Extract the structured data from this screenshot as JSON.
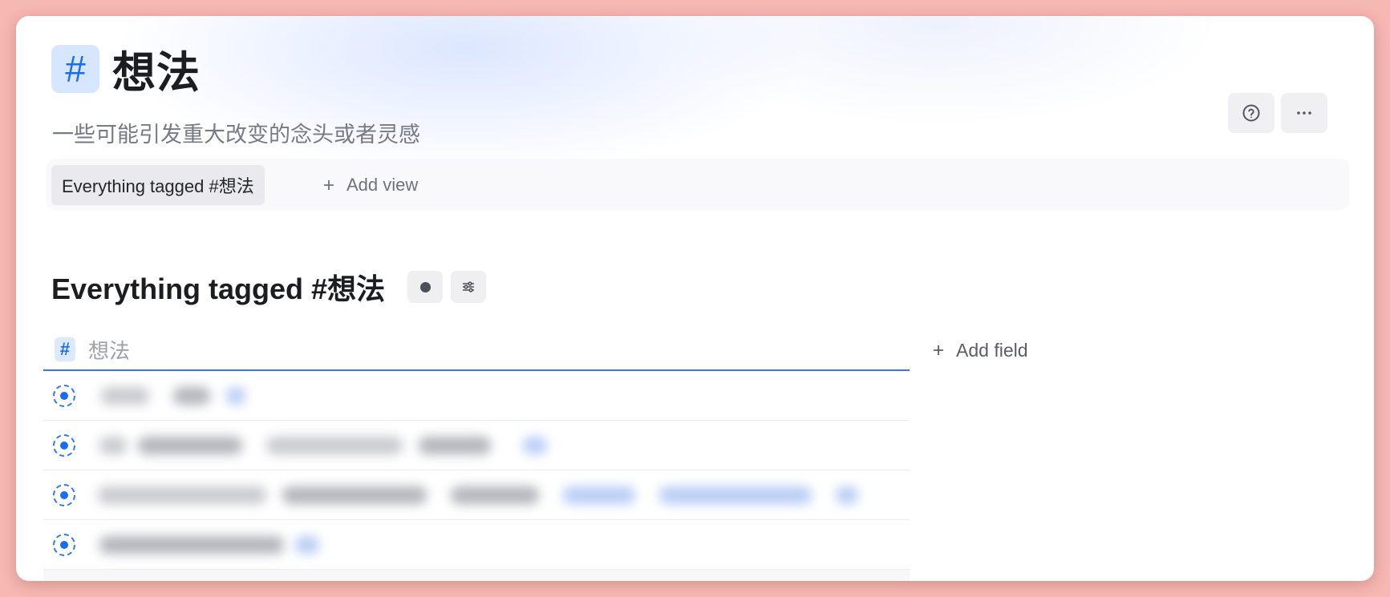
{
  "header": {
    "tag_symbol": "#",
    "title": "想法",
    "description": "一些可能引发重大改变的念头或者灵感"
  },
  "views": {
    "active_view": "Everything tagged #想法",
    "add_view_label": "Add view"
  },
  "section": {
    "title": "Everything tagged #想法"
  },
  "table": {
    "column_hash": "#",
    "column_label": "想法",
    "add_field_label": "Add field",
    "row_count": 4
  },
  "icons": {
    "help": "help-circle-icon",
    "more": "more-horizontal-icon",
    "plus": "plus-icon",
    "display": "dot-icon",
    "settings": "sliders-icon",
    "bullet": "tag-bullet-icon"
  },
  "colors": {
    "accent": "#1a6cf0",
    "background": "#f6b8b3"
  }
}
